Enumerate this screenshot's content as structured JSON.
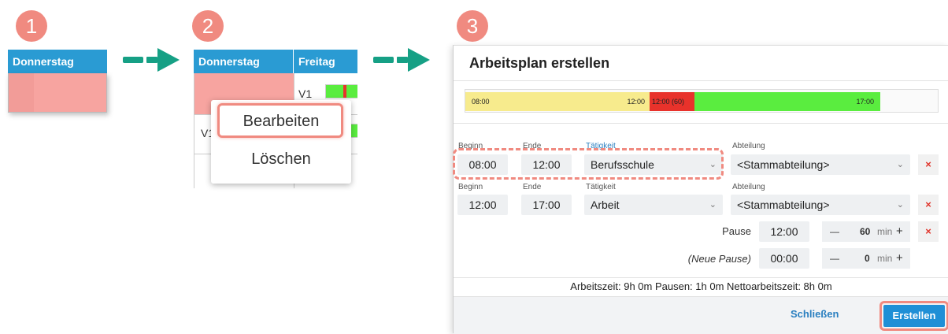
{
  "steps": {
    "one": "1",
    "two": "2",
    "three": "3"
  },
  "colors": {
    "badge": "#f08a80",
    "header_blue": "#2a9bd3",
    "cell_red": "#f7a4a0",
    "arrow_green": "#16a085",
    "timeline_yellow": "#f7eb8d",
    "timeline_red": "#e8322b",
    "timeline_green": "#5aed3f",
    "button_blue": "#1f8fd6"
  },
  "panel1": {
    "day_header": "Donnerstag"
  },
  "panel2": {
    "day_header_a": "Donnerstag",
    "day_header_b": "Freitag",
    "row_label_1": "V1",
    "row_label_2": "V1",
    "context_menu": {
      "edit": "Bearbeiten",
      "delete": "Löschen"
    }
  },
  "dialog": {
    "title": "Arbeitsplan erstellen",
    "timeline": {
      "seg1_start": "08:00",
      "seg1_end": "12:00",
      "seg2_label": "12:00 (60)",
      "seg3_end": "17:00"
    },
    "row1": {
      "label_begin": "Beginn",
      "label_end": "Ende",
      "label_activity": "Tätigkeit",
      "label_department": "Abteilung",
      "begin": "08:00",
      "end": "12:00",
      "activity": "Berufsschule",
      "department": "<Stammabteilung>",
      "remove": "×"
    },
    "row2": {
      "label_begin": "Beginn",
      "label_end": "Ende",
      "label_activity": "Tätigkeit",
      "label_department": "Abteilung",
      "begin": "12:00",
      "end": "17:00",
      "activity": "Arbeit",
      "department": "<Stammabteilung>",
      "remove": "×"
    },
    "pause": {
      "label": "Pause",
      "time": "12:00",
      "minus": "—",
      "value": "60",
      "unit": "min",
      "plus": "+",
      "remove": "×"
    },
    "new_pause": {
      "label": "(Neue Pause)",
      "time": "00:00",
      "minus": "—",
      "value": "0",
      "unit": "min",
      "plus": "+"
    },
    "summary": "Arbeitszeit: 9h 0m Pausen: 1h 0m Nettoarbeitszeit: 8h 0m",
    "close_button": "Schließen",
    "create_button": "Erstellen"
  }
}
